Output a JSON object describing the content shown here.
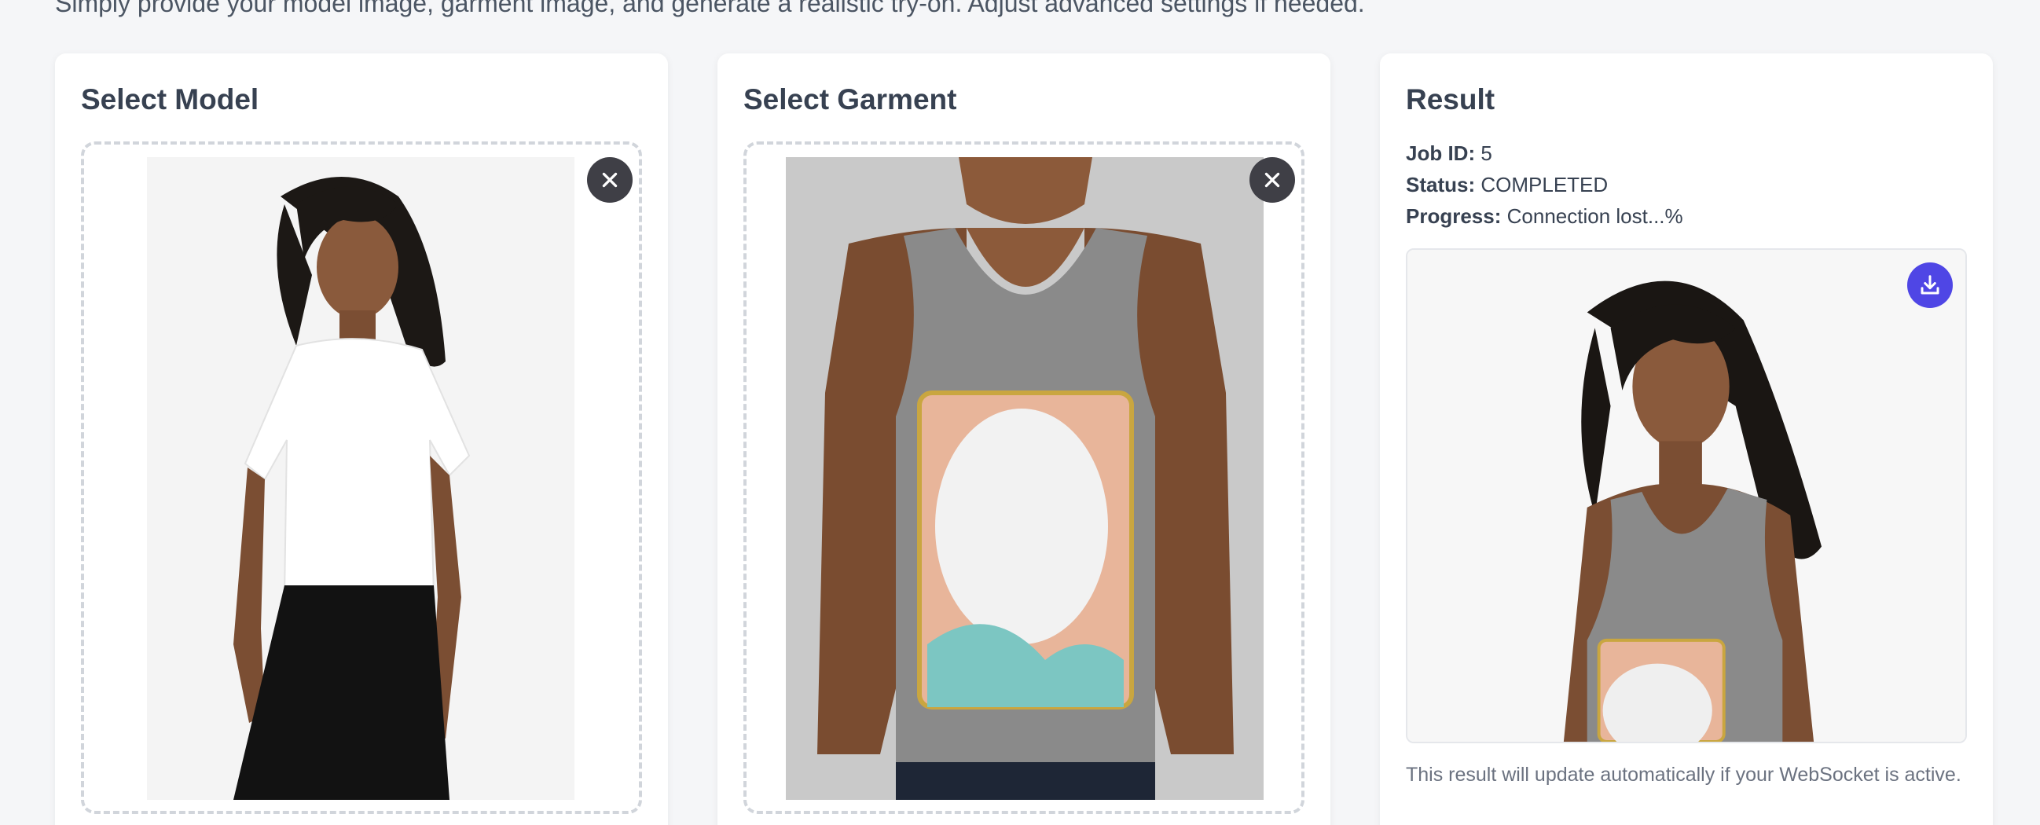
{
  "page": {
    "subtitle": "Simply provide your model image, garment image, and generate a realistic try-on. Adjust advanced settings if needed."
  },
  "model_card": {
    "title": "Select Model",
    "remove_icon": "close-icon"
  },
  "garment_card": {
    "title": "Select Garment",
    "remove_icon": "close-icon"
  },
  "result_card": {
    "title": "Result",
    "job_id_label": "Job ID:",
    "job_id_value": "5",
    "status_label": "Status:",
    "status_value": "COMPLETED",
    "progress_label": "Progress:",
    "progress_value": "Connection lost...%",
    "download_icon": "download-icon",
    "note": "This result will update automatically if your WebSocket is active."
  },
  "colors": {
    "accent": "#4f46e5",
    "close_button": "#3f3f46",
    "card_background": "#ffffff",
    "page_background": "#f5f6f8"
  }
}
